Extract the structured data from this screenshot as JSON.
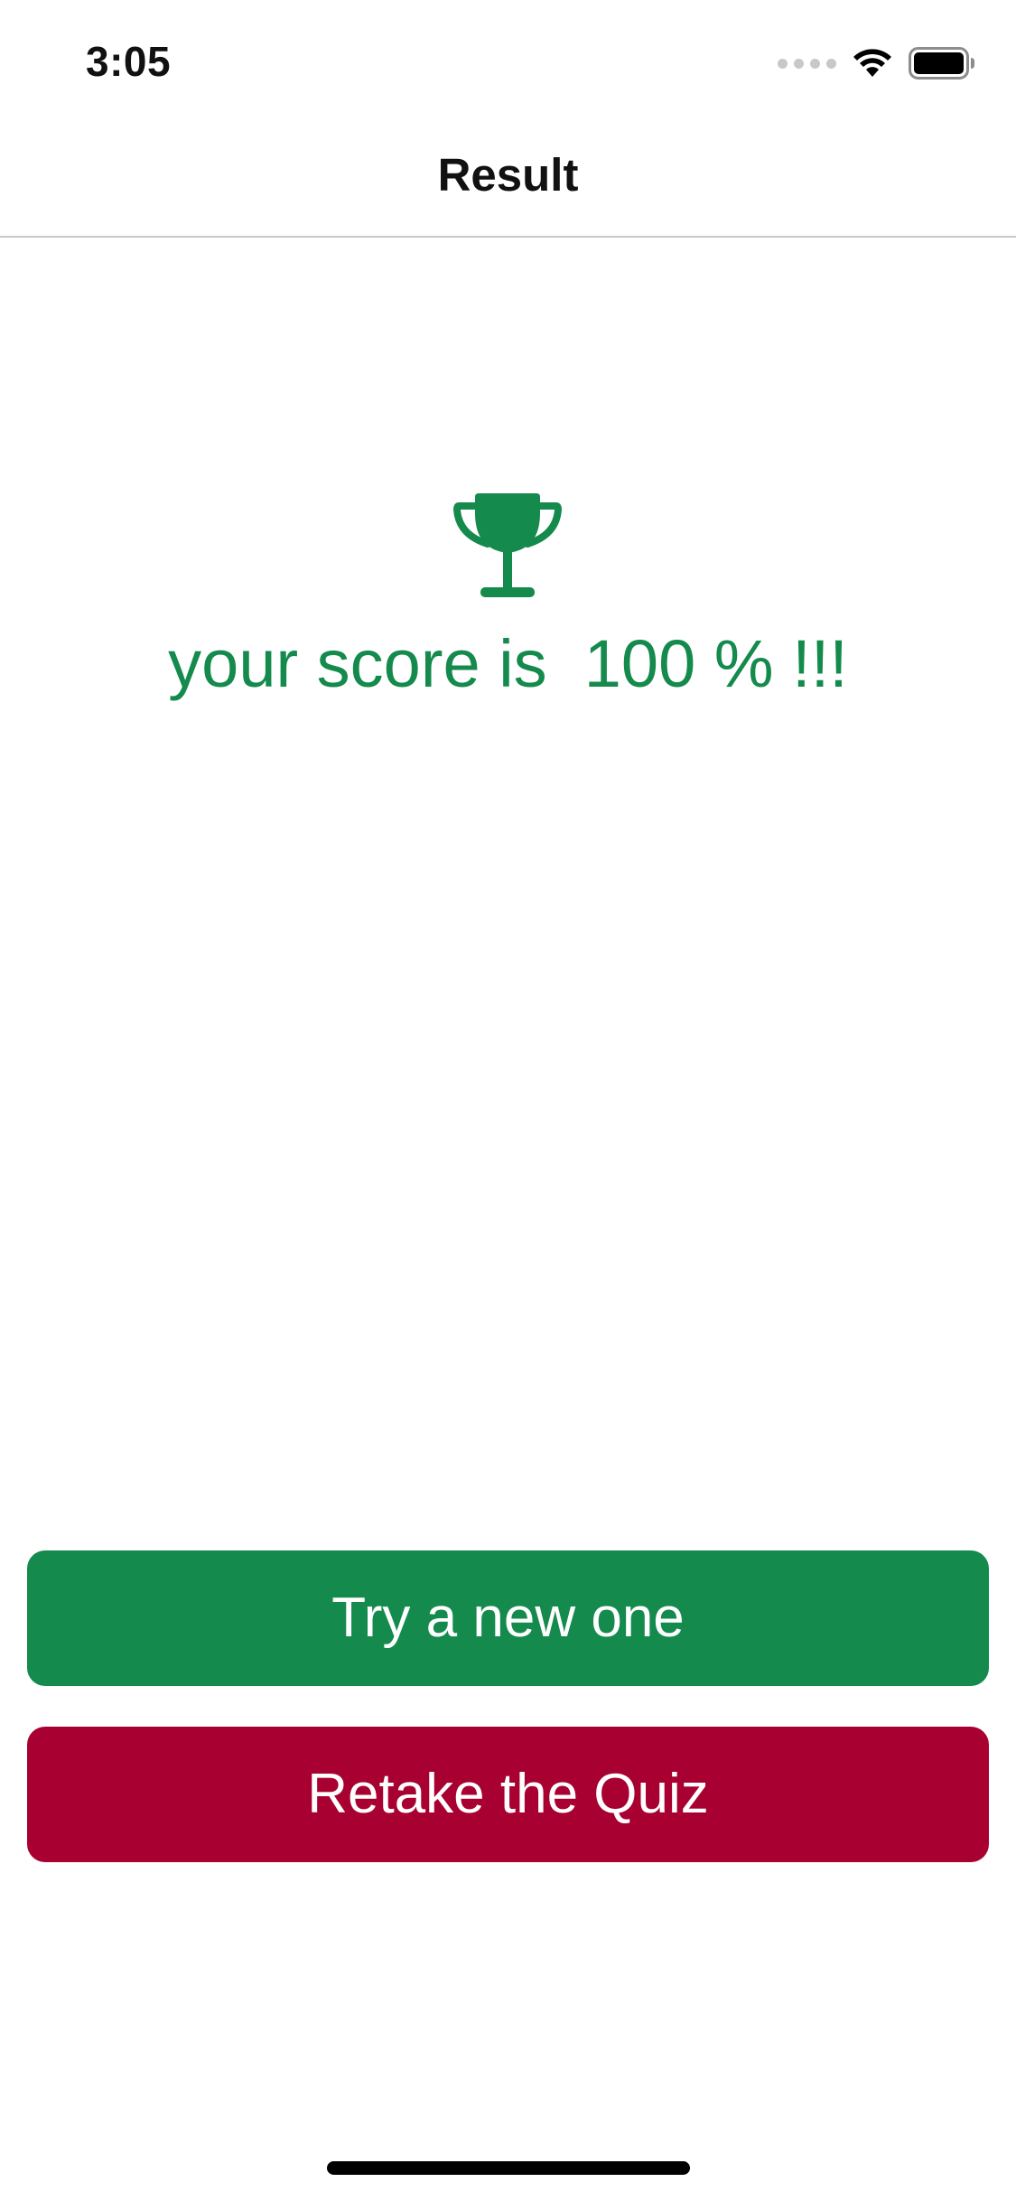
{
  "status_bar": {
    "time": "3:05",
    "icons": [
      "cellular-signal-icon",
      "wifi-icon",
      "battery-icon"
    ]
  },
  "nav": {
    "title": "Result"
  },
  "result": {
    "icon": "trophy-icon",
    "score_text": "your score is  100 % !!!",
    "accent_color": "#148a4d"
  },
  "buttons": {
    "new_quiz_label": "Try a new one",
    "retake_label": "Retake the Quiz",
    "new_quiz_color": "#148a4d",
    "retake_color": "#a80030"
  }
}
